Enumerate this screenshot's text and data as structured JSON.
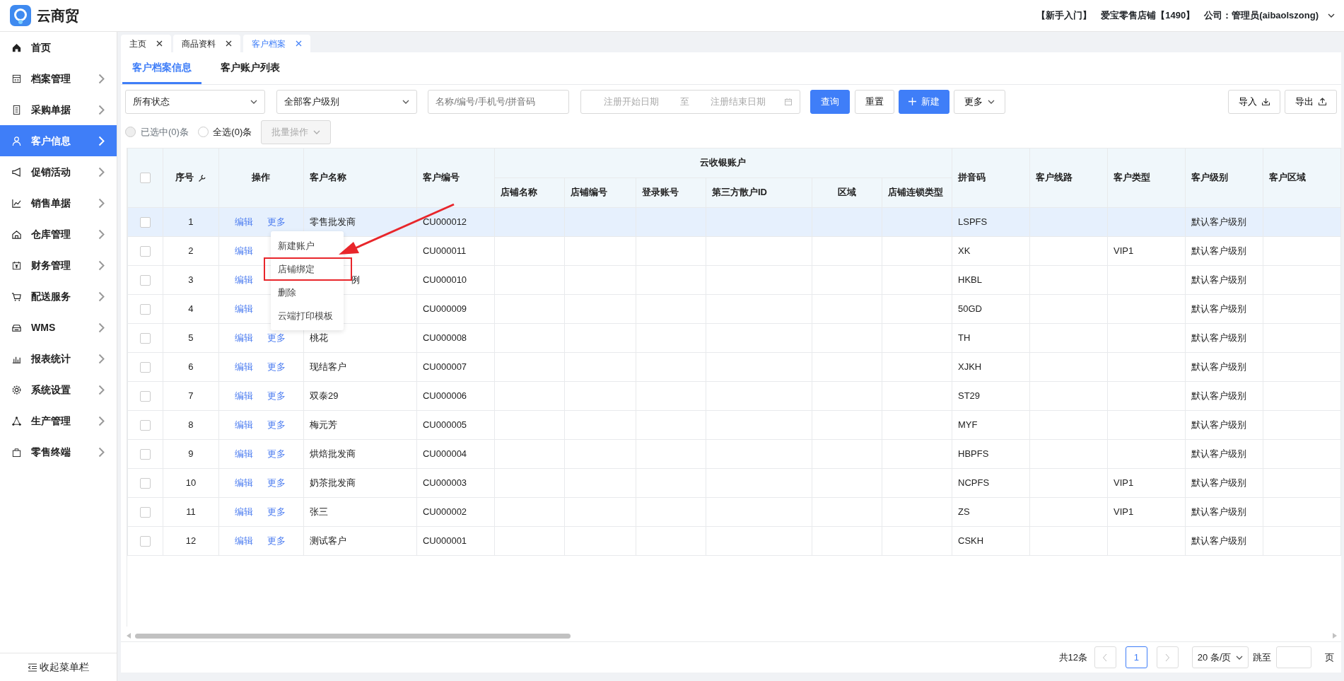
{
  "header": {
    "app_name": "云商贸",
    "links": [
      "【新手入门】",
      "爱宝零售店铺【1490】",
      "公司：管理员(aibaolszong)"
    ]
  },
  "sidebar": {
    "items": [
      {
        "label": "首页",
        "expandable": false,
        "selected": false
      },
      {
        "label": "档案管理",
        "expandable": true,
        "selected": false
      },
      {
        "label": "采购单据",
        "expandable": true,
        "selected": false
      },
      {
        "label": "客户信息",
        "expandable": true,
        "selected": true
      },
      {
        "label": "促销活动",
        "expandable": true,
        "selected": false
      },
      {
        "label": "销售单据",
        "expandable": true,
        "selected": false
      },
      {
        "label": "仓库管理",
        "expandable": true,
        "selected": false
      },
      {
        "label": "财务管理",
        "expandable": true,
        "selected": false
      },
      {
        "label": "配送服务",
        "expandable": true,
        "selected": false
      },
      {
        "label": "WMS",
        "expandable": true,
        "selected": false
      },
      {
        "label": "报表统计",
        "expandable": true,
        "selected": false
      },
      {
        "label": "系统设置",
        "expandable": true,
        "selected": false
      },
      {
        "label": "生产管理",
        "expandable": true,
        "selected": false
      },
      {
        "label": "零售终端",
        "expandable": true,
        "selected": false
      }
    ],
    "collapse_label": "收起菜单栏"
  },
  "page_tabs": [
    {
      "label": "主页",
      "selected": false
    },
    {
      "label": "商品资料",
      "selected": false
    },
    {
      "label": "客户档案",
      "selected": true
    }
  ],
  "sub_tabs": [
    {
      "label": "客户档案信息",
      "selected": true
    },
    {
      "label": "客户账户列表",
      "selected": false
    }
  ],
  "filters": {
    "status_select": "所有状态",
    "level_select": "全部客户级别",
    "search": {
      "placeholder": "名称/编号/手机号/拼音码"
    },
    "date_range": {
      "start_placeholder": "注册开始日期",
      "separator": "至",
      "end_placeholder": "注册结束日期"
    }
  },
  "buttons": [
    {
      "label": "查询",
      "kind": "primary"
    },
    {
      "label": "重置",
      "kind": "default"
    },
    {
      "label": "新建",
      "kind": "add"
    },
    {
      "label": "更多",
      "kind": "dropdown"
    }
  ],
  "right_buttons": [
    {
      "label": "导入",
      "kind": "import"
    },
    {
      "label": "导出",
      "kind": "export"
    }
  ],
  "selection": {
    "options": [
      {
        "label": "已选中(0)条",
        "disabled": true,
        "selected": false
      },
      {
        "label": "全选(0)条",
        "disabled": false,
        "selected": false
      }
    ],
    "batch_button": {
      "label": "批量操作",
      "disabled": true
    }
  },
  "table": {
    "all_checked": false,
    "columns": [
      {
        "label": "序号"
      },
      {
        "label": "操作"
      },
      {
        "label": "客户名称"
      },
      {
        "label": "客户编号"
      },
      {
        "label": "云收银账户",
        "children": [
          {
            "label": "店铺名称"
          },
          {
            "label": "店铺编号"
          },
          {
            "label": "登录账号"
          },
          {
            "label": "第三方散户ID"
          },
          {
            "label": "区域"
          },
          {
            "label": "店铺连锁类型"
          }
        ]
      },
      {
        "label": "拼音码"
      },
      {
        "label": "客户线路"
      },
      {
        "label": "客户类型"
      },
      {
        "label": "客户级别"
      },
      {
        "label": "客户区域"
      }
    ],
    "rows": [
      {
        "index": "1",
        "checked": false,
        "highlighted": true,
        "edit": "编辑",
        "more": "更多",
        "name": "零售批发商",
        "code": "CU000012",
        "pinyin": "LSPFS",
        "level": "默认客户级别"
      },
      {
        "index": "2",
        "checked": false,
        "highlighted": false,
        "edit": "编辑",
        "code": "CU000011",
        "pinyin": "XK",
        "type": "VIP1",
        "level": "默认客户级别"
      },
      {
        "index": "3",
        "checked": false,
        "highlighted": false,
        "edit": "编辑",
        "name": "例",
        "name_partly_covered": true,
        "code": "CU000010",
        "pinyin": "HKBL",
        "level": "默认客户级别"
      },
      {
        "index": "4",
        "checked": false,
        "highlighted": false,
        "edit": "编辑",
        "code": "CU000009",
        "pinyin": "50GD",
        "level": "默认客户级别"
      },
      {
        "index": "5",
        "checked": false,
        "highlighted": false,
        "edit": "编辑",
        "more": "更多",
        "name": "桃花",
        "code": "CU000008",
        "pinyin": "TH",
        "level": "默认客户级别"
      },
      {
        "index": "6",
        "checked": false,
        "highlighted": false,
        "edit": "编辑",
        "more": "更多",
        "name": "现结客户",
        "code": "CU000007",
        "pinyin": "XJKH",
        "level": "默认客户级别"
      },
      {
        "index": "7",
        "checked": false,
        "highlighted": false,
        "edit": "编辑",
        "more": "更多",
        "name": "双泰29",
        "code": "CU000006",
        "pinyin": "ST29",
        "level": "默认客户级别"
      },
      {
        "index": "8",
        "checked": false,
        "highlighted": false,
        "edit": "编辑",
        "more": "更多",
        "name": "梅元芳",
        "code": "CU000005",
        "pinyin": "MYF",
        "level": "默认客户级别"
      },
      {
        "index": "9",
        "checked": false,
        "highlighted": false,
        "edit": "编辑",
        "more": "更多",
        "name": "烘焙批发商",
        "code": "CU000004",
        "pinyin": "HBPFS",
        "level": "默认客户级别"
      },
      {
        "index": "10",
        "checked": false,
        "highlighted": false,
        "edit": "编辑",
        "more": "更多",
        "name": "奶茶批发商",
        "code": "CU000003",
        "pinyin": "NCPFS",
        "type": "VIP1",
        "level": "默认客户级别"
      },
      {
        "index": "11",
        "checked": false,
        "highlighted": false,
        "edit": "编辑",
        "more": "更多",
        "name": "张三",
        "code": "CU000002",
        "pinyin": "ZS",
        "type": "VIP1",
        "level": "默认客户级别"
      },
      {
        "index": "12",
        "checked": false,
        "highlighted": false,
        "edit": "编辑",
        "more": "更多",
        "name": "测试客户",
        "code": "CU000001",
        "pinyin": "CSKH",
        "level": "默认客户级别"
      }
    ]
  },
  "context_menu": {
    "items": [
      {
        "label": "新建账户",
        "marked": false
      },
      {
        "label": "店铺绑定",
        "marked": true
      },
      {
        "label": "删除",
        "marked": false
      },
      {
        "label": "云端打印模板",
        "marked": false
      }
    ]
  },
  "pagination": {
    "total": "共12条",
    "pages": [
      {
        "label": "1",
        "selected": true
      }
    ],
    "page_size": "20 条/页",
    "jump_label": "跳至",
    "page_suffix": "页"
  }
}
